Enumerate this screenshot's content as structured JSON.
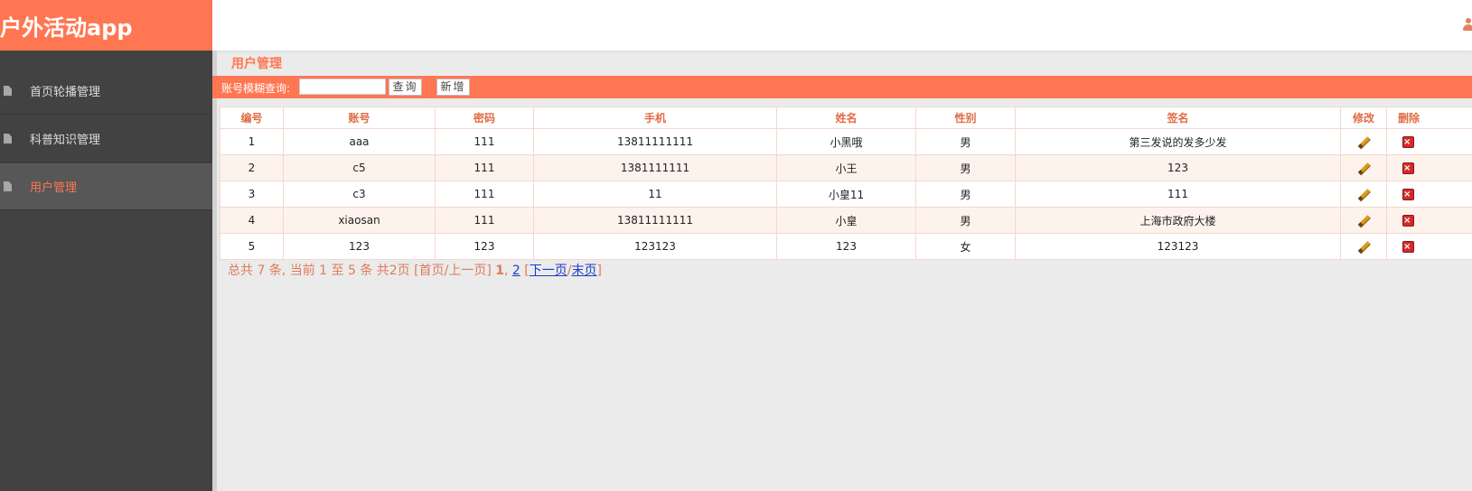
{
  "app": {
    "title": "户外活动app"
  },
  "sidebar": {
    "items": [
      {
        "label": "首页轮播管理",
        "active": false
      },
      {
        "label": "科普知识管理",
        "active": false
      },
      {
        "label": "用户管理",
        "active": true
      }
    ]
  },
  "main": {
    "section_title": "用户管理",
    "search": {
      "label": "账号模糊查询:",
      "value": "",
      "query_label": "查询",
      "add_label": "新增"
    },
    "table": {
      "columns": [
        "编号",
        "账号",
        "密码",
        "手机",
        "姓名",
        "性别",
        "签名",
        "修改",
        "删除"
      ],
      "rows": [
        {
          "id": "1",
          "account": "aaa",
          "password": "111",
          "phone": "13811111111",
          "name": "小黑哦",
          "gender": "男",
          "signature": "第三发说的发多少发"
        },
        {
          "id": "2",
          "account": "c5",
          "password": "111",
          "phone": "1381111111",
          "name": "小王",
          "gender": "男",
          "signature": "123"
        },
        {
          "id": "3",
          "account": "c3",
          "password": "111",
          "phone": "11",
          "name": "小皇11",
          "gender": "男",
          "signature": "111"
        },
        {
          "id": "4",
          "account": "xiaosan",
          "password": "111",
          "phone": "13811111111",
          "name": "小皇",
          "gender": "男",
          "signature": "上海市政府大楼"
        },
        {
          "id": "5",
          "account": "123",
          "password": "123",
          "phone": "123123",
          "name": "123",
          "gender": "女",
          "signature": "123123"
        }
      ]
    },
    "pagination": {
      "summary": "总共 7 条, 当前 1 至 5 条 共2页",
      "first_prev": "[首页/上一页]",
      "page1": "1",
      "comma": ",",
      "page2": "2",
      "bracket_open": "[",
      "next": "下一页",
      "slash": "/",
      "last": "末页",
      "bracket_close": "]"
    }
  }
}
